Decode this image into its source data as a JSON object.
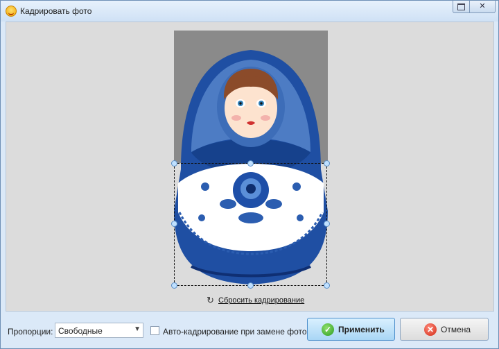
{
  "window": {
    "title": "Кадрировать фото"
  },
  "editor": {
    "reset_label": "Сбросить кадрирование"
  },
  "toolbar": {
    "proportions_label": "Пропорции:",
    "proportions_value": "Свободные",
    "auto_crop_label": "Авто-кадрирование при замене фото",
    "auto_crop_checked": false,
    "apply_label": "Применить",
    "cancel_label": "Отмена"
  },
  "colors": {
    "accent": "#4c8ecb",
    "canvas": "#dcdcdc",
    "doll_blue": "#1f4fa3"
  }
}
